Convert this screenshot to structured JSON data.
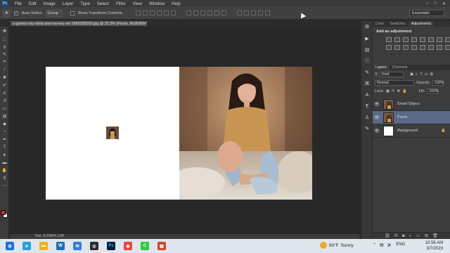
{
  "app": {
    "menus": [
      "File",
      "Edit",
      "Image",
      "Layer",
      "Type",
      "Select",
      "Filter",
      "View",
      "Window",
      "Help"
    ],
    "window_controls": [
      "–",
      "□",
      "✕"
    ]
  },
  "options_bar": {
    "auto_select_label": "Auto-Select",
    "auto_select_checked": "✓",
    "auto_select_mode": "Group",
    "transform_controls_label": "Show Transform Controls",
    "workspace": "Essentials"
  },
  "document": {
    "tab_title": "a-gomez-my-mind-and-me-key-art-1663335059.jpg @ 33.3% (Pixels, RGB/8#) *",
    "tab_close": "×",
    "status": "Doc: 8.23M/4.13M"
  },
  "panels": {
    "top_tabs": [
      "Color",
      "Swatches",
      "Adjustments"
    ],
    "adjustments_title": "Add an adjustment",
    "layer_tabs": [
      "Layers",
      "Channels"
    ],
    "filter_kind": "Kind",
    "blend_mode": "Normal",
    "opacity_label": "Opacity:",
    "opacity_value": "100%",
    "lock_label": "Lock:",
    "fill_label": "Fill:",
    "fill_value": "100%",
    "layers": [
      {
        "name": "Smart Object",
        "visible": "👁"
      },
      {
        "name": "Pixels",
        "visible": "👁"
      },
      {
        "name": "Background",
        "visible": "👁"
      }
    ]
  },
  "taskbar": {
    "weather_temp": "83°F",
    "weather_text": "Sunny",
    "language": "ENG",
    "time": "10:56 AM",
    "date": "3/7/2023"
  },
  "colors": {
    "foreground": "#c0321e",
    "background": "#ffffff",
    "selected_layer": "#5a6a86"
  }
}
